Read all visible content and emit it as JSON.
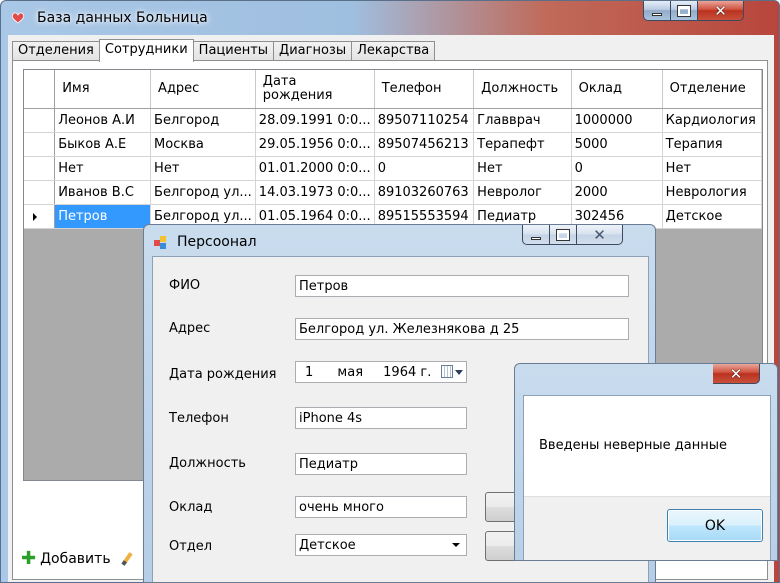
{
  "main_window": {
    "title": "База данных Больница",
    "tabs": [
      {
        "label": "Отделения"
      },
      {
        "label": "Сотрудники"
      },
      {
        "label": "Пациенты"
      },
      {
        "label": "Диагнозы"
      },
      {
        "label": "Лекарства"
      }
    ],
    "active_tab": "Сотрудники",
    "grid": {
      "columns": [
        "Имя",
        "Адрес",
        "Дата рождения",
        "Телефон",
        "Должность",
        "Оклад",
        "Отделение"
      ],
      "rows": [
        [
          "Леонов А.И",
          "Белгород",
          "28.09.1991 0:0...",
          "89507110254",
          "Главврач",
          "1000000",
          "Кардиология"
        ],
        [
          "Быков А.Е",
          "Москва",
          "29.05.1956 0:0...",
          "89507456213",
          "Терапефт",
          "5000",
          "Терапия"
        ],
        [
          "Нет",
          "Нет",
          "01.01.2000 0:0...",
          "0",
          "Нет",
          "0",
          "Нет"
        ],
        [
          "Иванов В.С",
          "Белгород ул...",
          "14.03.1973 0:0...",
          "89103260763",
          "Невролог",
          "2000",
          "Неврология"
        ],
        [
          "Петров",
          "Белгород ул...",
          "01.05.1964 0:0...",
          "89515553594",
          "Педиатр",
          "302456",
          "Детское"
        ]
      ]
    },
    "bottom_toolbar": {
      "add_label": "Добавить"
    }
  },
  "personnel_dialog": {
    "title": "Персоонал",
    "labels": {
      "fio": "ФИО",
      "address": "Адрес",
      "birth_date": "Дата рождения",
      "phone": "Телефон",
      "position": "Должность",
      "salary": "Оклад",
      "department": "Отдел"
    },
    "values": {
      "fio": "Петров",
      "address": "Белгород ул. Железнякова д 25",
      "birth_day": "1",
      "birth_month": "мая",
      "birth_year": "1964 г.",
      "phone": "iPhone 4s",
      "position": "Педиатр",
      "salary": "очень много",
      "department": "Детское"
    }
  },
  "message_box": {
    "text": "Введены неверные данные",
    "ok_label": "OK"
  },
  "icons": {
    "close": "close-icon",
    "minimize": "minimize-icon",
    "maximize": "maximize-icon",
    "add": "plus-icon",
    "edit": "pencil-icon",
    "calendar": "calendar-icon",
    "dropdown": "chevron-down-icon"
  },
  "colors": {
    "selection": "#3399ff",
    "close_button": "#c9503b",
    "add_icon": "#2aa02a"
  }
}
